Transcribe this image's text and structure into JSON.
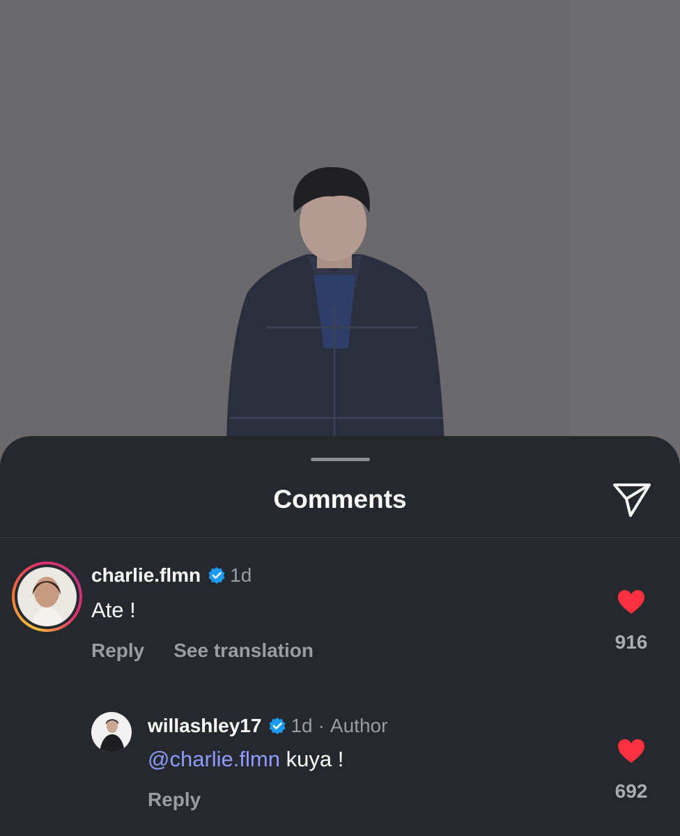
{
  "sheet": {
    "title": "Comments",
    "share_icon": "paper-plane-icon"
  },
  "comments": [
    {
      "username": "charlie.flmn",
      "verified": true,
      "time": "1d",
      "text": "Ate !",
      "reply_label": "Reply",
      "translate_label": "See translation",
      "like_icon": "heart-filled-icon",
      "likes": "916"
    },
    {
      "username": "willashley17",
      "verified": true,
      "time": "1d",
      "separator": "·",
      "author_label": "Author",
      "mention": "@charlie.flmn",
      "text": "kuya !",
      "reply_label": "Reply",
      "like_icon": "heart-filled-icon",
      "likes": "692"
    }
  ],
  "colors": {
    "sheet_bg": "#25282d",
    "verified_blue": "#1d9bf0",
    "heart_red": "#ff3040",
    "mention": "#8f9cff"
  }
}
